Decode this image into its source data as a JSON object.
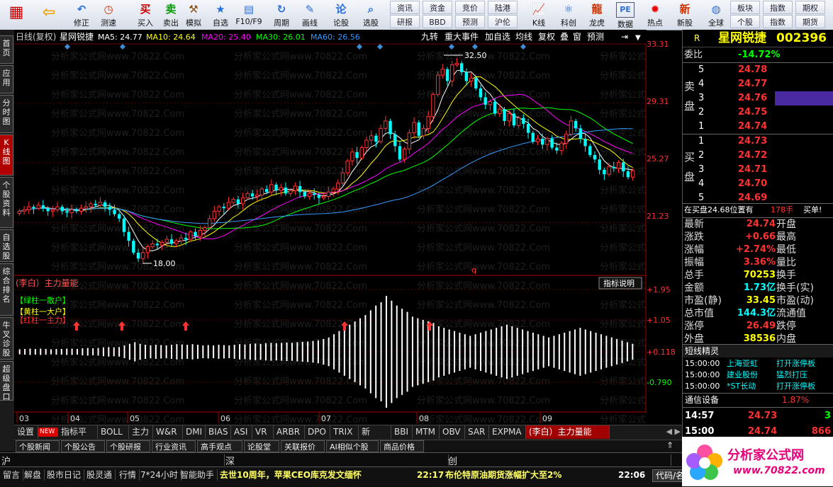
{
  "toolbar": {
    "main_buttons": [
      {
        "label": "",
        "icon": "grid-icon"
      },
      {
        "label": "",
        "icon": "back-arrow-icon"
      },
      {
        "label": "修正",
        "icon": "undo-icon"
      },
      {
        "label": "测速",
        "icon": "clock-icon"
      },
      {
        "label": "买入",
        "icon": "buy-icon",
        "glyph": "买"
      },
      {
        "label": "卖出",
        "icon": "sell-icon",
        "glyph": "卖"
      },
      {
        "label": "模拟",
        "icon": "hammer-icon"
      },
      {
        "label": "自选",
        "icon": "star-icon"
      },
      {
        "label": "F10/F9",
        "icon": "f10-icon"
      },
      {
        "label": "周期",
        "icon": "cycle-icon"
      },
      {
        "label": "画线",
        "icon": "pencil-icon"
      },
      {
        "label": "论股",
        "icon": "discuss-icon"
      },
      {
        "label": "选股",
        "icon": "search-icon"
      }
    ],
    "grid_top": [
      "资讯",
      "资金",
      "竞价",
      "陆港"
    ],
    "grid_bottom": [
      "研报",
      "BBD",
      "预测",
      "沪伦"
    ],
    "icon_buttons": [
      {
        "label": "K线",
        "icon": "kline-icon"
      },
      {
        "label": "科创",
        "icon": "sci-icon"
      },
      {
        "label": "龙虎",
        "icon": "dragon-icon"
      },
      {
        "label": "数据",
        "icon": "pe-icon",
        "glyph": "PE"
      },
      {
        "label": "热点",
        "icon": "hot-icon"
      },
      {
        "label": "新股",
        "icon": "new-stock-icon"
      },
      {
        "label": "全球",
        "icon": "globe-icon"
      }
    ],
    "right_top": [
      "板块",
      "指数",
      "期权"
    ],
    "right_bottom": [
      "个股",
      "指数",
      "期货"
    ]
  },
  "left_tabs": [
    "首页",
    "应用",
    "分时图",
    "K线图",
    "个股资料",
    "自选股",
    "综合排名",
    "牛叉诊股",
    "超级盘口"
  ],
  "chart": {
    "header": {
      "period": "日线(复权)",
      "name": "星网锐捷",
      "ma5": "MA5: 24.77",
      "ma10": "MA10: 24.64",
      "ma20": "MA20: 25.40",
      "ma30": "MA30: 26.01",
      "ma60": "MA60: 26.56",
      "buttons": [
        "九转",
        "重大事件",
        "加自选",
        "均线",
        "复权",
        "叠",
        "窗",
        "预测"
      ]
    },
    "y_ticks": [
      "33.31",
      "29.31",
      "25.27",
      "21.23"
    ],
    "high_label": "32.50",
    "low_label": "18.00",
    "marker_q": "q",
    "indicator": {
      "title": "(李白）主力量能",
      "legend": [
        "【绿柱一散户】",
        "【黄柱一大户】",
        "【红柱一主力】"
      ],
      "explain_button": "指标说明",
      "y_ticks": [
        "+1.95",
        "+1.05",
        "+0.118",
        "-0.790"
      ]
    },
    "x_ticks": [
      "03",
      "04",
      "05",
      "06",
      "07",
      "08",
      "09"
    ],
    "watermark": "分析家公式网www.70822.Com",
    "colors": {
      "up": "#ff3232",
      "down": "#00ffff",
      "ma5": "#ffffff",
      "ma10": "#ffff00",
      "ma20": "#ff00ff",
      "ma30": "#00ff00",
      "ma60": "#3399ff"
    }
  },
  "chart_data": {
    "type": "candlestick",
    "title": "星网锐捷",
    "x_labels": [
      "03",
      "04",
      "05",
      "06",
      "07",
      "08",
      "09"
    ],
    "ylim": [
      18,
      33.31
    ],
    "close": [
      22.0,
      22.1,
      22.3,
      22.2,
      22.4,
      22.2,
      22.0,
      22.1,
      22.3,
      22.0,
      21.9,
      22.1,
      22.0,
      22.2,
      22.3,
      22.5,
      22.4,
      22.6,
      22.3,
      22.1,
      21.8,
      21.5,
      20.6,
      20.0,
      19.2,
      18.8,
      19.2,
      19.6,
      19.8,
      19.7,
      19.9,
      20.1,
      19.8,
      20.0,
      20.2,
      20.1,
      20.6,
      20.3,
      20.7,
      20.9,
      21.5,
      22.0,
      22.3,
      22.2,
      22.6,
      22.8,
      22.5,
      22.9,
      23.2,
      23.0,
      23.1,
      23.5,
      23.3,
      23.8,
      23.4,
      23.6,
      23.2,
      23.4,
      23.7,
      23.3,
      23.0,
      23.2,
      23.1,
      22.9,
      23.0,
      23.3,
      23.5,
      23.9,
      24.6,
      25.4,
      26.0,
      25.6,
      26.3,
      26.8,
      27.1,
      26.7,
      27.6,
      28.1,
      27.2,
      26.4,
      25.5,
      26.2,
      27.3,
      28.0,
      27.1,
      27.6,
      28.4,
      29.9,
      31.2,
      31.6,
      30.8,
      31.9,
      32.0,
      31.4,
      30.8,
      31.0,
      30.3,
      29.7,
      29.2,
      29.4,
      28.6,
      28.9,
      28.1,
      28.6,
      27.8,
      28.3,
      27.9,
      27.3,
      26.7,
      26.9,
      26.5,
      26.9,
      26.3,
      26.1,
      26.6,
      27.2,
      28.1,
      27.6,
      26.9,
      26.4,
      25.8,
      25.5,
      24.8,
      24.5,
      25.0,
      24.9,
      25.3,
      24.7,
      24.3,
      24.74
    ],
    "indicator_values": [
      0.08,
      0.09,
      0.1,
      0.09,
      0.1,
      0.09,
      0.08,
      0.09,
      0.09,
      0.1,
      0.1,
      0.09,
      0.11,
      0.12,
      0.11,
      0.12,
      0.14,
      0.15,
      0.14,
      0.15,
      0.2,
      0.25,
      0.3,
      0.25,
      0.22,
      0.2,
      0.22,
      0.21,
      0.2,
      0.22,
      0.24,
      0.23,
      0.22,
      0.24,
      0.22,
      0.2,
      0.21,
      0.2,
      0.22,
      0.21,
      0.2,
      0.22,
      0.24,
      0.23,
      0.25,
      0.26,
      0.25,
      0.27,
      0.28,
      0.27,
      0.28,
      0.29,
      0.28,
      0.3,
      0.31,
      0.32,
      0.34,
      0.36,
      0.4,
      0.45,
      0.55,
      0.65,
      0.75,
      0.85,
      0.95,
      1.05,
      1.15,
      1.3,
      1.45,
      1.55,
      1.75,
      1.6,
      1.45,
      1.35,
      1.25,
      1.1,
      1.05,
      1.0,
      0.95,
      0.9,
      0.8,
      0.75,
      0.7,
      0.65,
      0.6,
      0.55,
      0.5,
      0.55,
      0.6,
      0.65,
      0.7,
      0.75,
      0.8,
      0.85,
      0.8,
      0.75,
      0.7,
      0.65,
      0.6,
      0.55,
      0.5,
      0.45,
      0.5,
      0.55,
      0.6,
      0.65,
      0.7,
      0.75,
      0.7,
      0.65,
      0.6,
      0.55,
      0.5,
      0.45,
      0.4,
      0.35,
      0.3,
      0.25
    ]
  },
  "quote": {
    "code_prefix": "R",
    "name": "星网锐捷",
    "code": "002396",
    "webi_label": "委比",
    "webi_value": "-14.72%",
    "sell_label": "卖盘",
    "buy_label": "买盘",
    "sell": [
      {
        "lvl": "5",
        "price": "24.78"
      },
      {
        "lvl": "4",
        "price": "24.77"
      },
      {
        "lvl": "3",
        "price": "24.76"
      },
      {
        "lvl": "2",
        "price": "24.75"
      },
      {
        "lvl": "1",
        "price": "24.74"
      }
    ],
    "buy": [
      {
        "lvl": "1",
        "price": "24.73"
      },
      {
        "lvl": "2",
        "price": "24.72"
      },
      {
        "lvl": "3",
        "price": "24.71"
      },
      {
        "lvl": "4",
        "price": "24.70"
      },
      {
        "lvl": "5",
        "price": "24.69"
      }
    ],
    "notice": "在买盘24.68位置有",
    "notice_qty": "178手",
    "notice_tag": "买单!",
    "stats": [
      [
        "最新",
        "24.74",
        "开盘",
        ""
      ],
      [
        "涨跌",
        "+0.66",
        "最高",
        ""
      ],
      [
        "涨幅",
        "+2.74%",
        "最低",
        ""
      ],
      [
        "振幅",
        "3.36%",
        "量比",
        ""
      ],
      [
        "总手",
        "70253",
        "换手",
        ""
      ],
      [
        "金额",
        "1.73亿",
        "换手(实)",
        ""
      ],
      [
        "市盈(静)",
        "33.45",
        "市盈(动)",
        ""
      ],
      [
        "总市值",
        "144.3亿",
        "流通值",
        ""
      ],
      [
        "涨停",
        "26.49",
        "跌停",
        ""
      ],
      [
        "外盘",
        "38536",
        "内盘",
        ""
      ]
    ],
    "elf_title": "短线精灵",
    "elf": [
      [
        "15:00:00",
        "上海亚虹",
        "打开涨停板"
      ],
      [
        "15:00:00",
        "建业股份",
        "猛烈打压"
      ],
      [
        "15:00:00",
        "*ST长动",
        "打开涨停板"
      ]
    ],
    "industry_label": "通信设备",
    "industry_change": "1.87%",
    "ticks": [
      [
        "14:57",
        "24.73",
        "3"
      ],
      [
        "15:00",
        "24.74",
        "866"
      ]
    ]
  },
  "bottom_tabs": [
    "设置",
    "NEW",
    "指标平台",
    "BOLL",
    "主力",
    "W&R",
    "DMI",
    "BIAS",
    "ASI",
    "VR",
    "ARBR",
    "DPO",
    "TRIX",
    "新DMA",
    "BBI",
    "MTM",
    "OBV",
    "SAR",
    "EXPMA",
    "(李白）主力量能"
  ],
  "news_tabs": [
    "个股新闻",
    "个股公告",
    "个股研报",
    "行业资讯",
    "高手观点",
    "论股堂",
    "关联报价",
    "AI相似个股",
    "商品价格"
  ],
  "index_bar": [
    "沪",
    "深",
    "创"
  ],
  "statusbar": {
    "items": [
      "留言",
      "解盘",
      "股市日记",
      "股灵通",
      "行情",
      "7*24小时",
      "智能助手"
    ],
    "ticker1": "去世10周年，苹果CEO库克发文缅怀",
    "ticker2_time": "22:17",
    "ticker2": "布伦特原油期货涨幅扩大至2%",
    "clock": "22:06",
    "code_label": "代码/名",
    "logo_text": "分析家公式网",
    "logo_url": "www.70822.com"
  }
}
